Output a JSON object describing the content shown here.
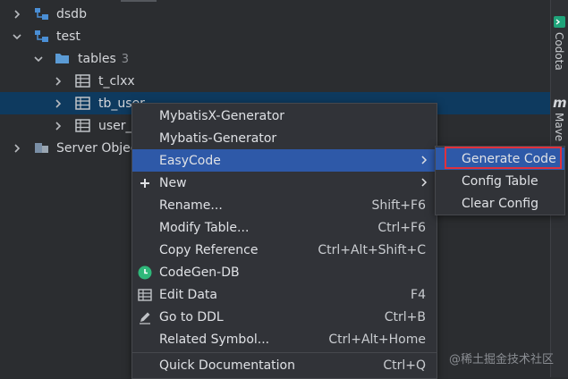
{
  "tree": {
    "items": [
      {
        "label": "dsdb",
        "count": ""
      },
      {
        "label": "test",
        "count": ""
      },
      {
        "label": "tables",
        "count": "3"
      },
      {
        "label": "t_clxx",
        "count": ""
      },
      {
        "label": "tb_user",
        "count": ""
      },
      {
        "label": "user_i",
        "count": ""
      },
      {
        "label": "Server Objec",
        "count": ""
      }
    ]
  },
  "right_strip": {
    "codota": "Codota",
    "maven": "Mave"
  },
  "context_menu": {
    "items": [
      {
        "label": "MybatisX-Generator",
        "shortcut": ""
      },
      {
        "label": "Mybatis-Generator",
        "shortcut": ""
      },
      {
        "label": "EasyCode",
        "shortcut": ""
      },
      {
        "label": "New",
        "shortcut": ""
      },
      {
        "label": "Rename...",
        "shortcut": "Shift+F6"
      },
      {
        "label": "Modify Table...",
        "shortcut": "Ctrl+F6"
      },
      {
        "label": "Copy Reference",
        "shortcut": "Ctrl+Alt+Shift+C"
      },
      {
        "label": "CodeGen-DB",
        "shortcut": ""
      },
      {
        "label": "Edit Data",
        "shortcut": "F4"
      },
      {
        "label": "Go to DDL",
        "shortcut": "Ctrl+B"
      },
      {
        "label": "Related Symbol...",
        "shortcut": "Ctrl+Alt+Home"
      },
      {
        "label": "Quick Documentation",
        "shortcut": "Ctrl+Q"
      }
    ]
  },
  "submenu": {
    "items": [
      {
        "label": "Generate Code"
      },
      {
        "label": "Config Table"
      },
      {
        "label": "Clear Config"
      }
    ]
  },
  "watermark": "@稀土掘金技术社区",
  "colors": {
    "selection": "#2e59a8",
    "tree_selection": "#0e3a5f",
    "highlight_box": "#e0313d"
  }
}
